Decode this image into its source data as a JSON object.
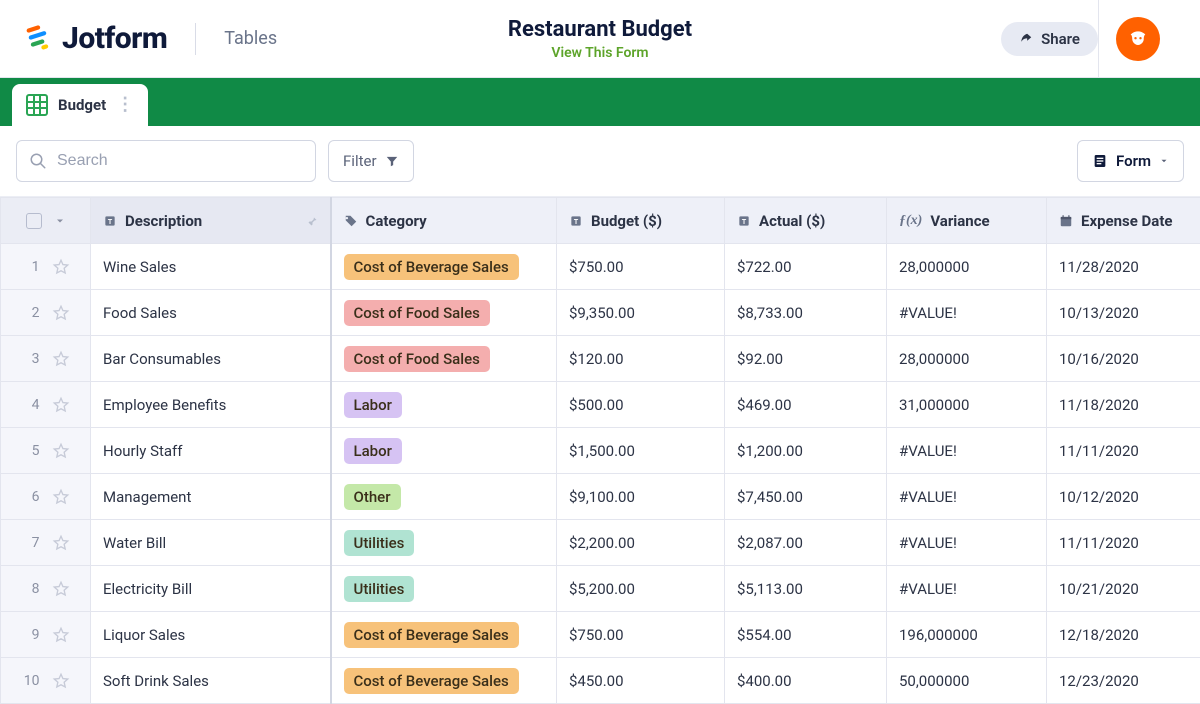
{
  "header": {
    "brand": "Jotform",
    "section": "Tables",
    "title": "Restaurant Budget",
    "view_link": "View This Form",
    "share": "Share"
  },
  "tabs": {
    "active": "Budget"
  },
  "toolbar": {
    "search_placeholder": "Search",
    "filter": "Filter",
    "form": "Form"
  },
  "columns": {
    "description": "Description",
    "category": "Category",
    "budget": "Budget ($)",
    "actual": "Actual ($)",
    "variance": "Variance",
    "expense_date": "Expense Date"
  },
  "category_styles": {
    "Cost of Beverage Sales": "tag-bev",
    "Cost of Food Sales": "tag-food",
    "Labor": "tag-labor",
    "Other": "tag-other",
    "Utilities": "tag-util"
  },
  "rows": [
    {
      "n": "1",
      "description": "Wine Sales",
      "category": "Cost of Beverage Sales",
      "budget": "$750.00",
      "actual": "$722.00",
      "variance": "28,000000",
      "date": "11/28/2020"
    },
    {
      "n": "2",
      "description": "Food Sales",
      "category": "Cost of Food Sales",
      "budget": "$9,350.00",
      "actual": "$8,733.00",
      "variance": "#VALUE!",
      "date": "10/13/2020"
    },
    {
      "n": "3",
      "description": "Bar Consumables",
      "category": "Cost of Food Sales",
      "budget": "$120.00",
      "actual": "$92.00",
      "variance": "28,000000",
      "date": "10/16/2020"
    },
    {
      "n": "4",
      "description": "Employee Benefits",
      "category": "Labor",
      "budget": "$500.00",
      "actual": "$469.00",
      "variance": "31,000000",
      "date": "11/18/2020"
    },
    {
      "n": "5",
      "description": "Hourly Staff",
      "category": "Labor",
      "budget": "$1,500.00",
      "actual": "$1,200.00",
      "variance": "#VALUE!",
      "date": "11/11/2020"
    },
    {
      "n": "6",
      "description": "Management",
      "category": "Other",
      "budget": "$9,100.00",
      "actual": "$7,450.00",
      "variance": "#VALUE!",
      "date": "10/12/2020"
    },
    {
      "n": "7",
      "description": "Water Bill",
      "category": "Utilities",
      "budget": "$2,200.00",
      "actual": "$2,087.00",
      "variance": "#VALUE!",
      "date": "11/11/2020"
    },
    {
      "n": "8",
      "description": "Electricity Bill",
      "category": "Utilities",
      "budget": "$5,200.00",
      "actual": "$5,113.00",
      "variance": "#VALUE!",
      "date": "10/21/2020"
    },
    {
      "n": "9",
      "description": "Liquor Sales",
      "category": "Cost of Beverage Sales",
      "budget": "$750.00",
      "actual": "$554.00",
      "variance": "196,000000",
      "date": "12/18/2020"
    },
    {
      "n": "10",
      "description": "Soft Drink Sales",
      "category": "Cost of Beverage Sales",
      "budget": "$450.00",
      "actual": "$400.00",
      "variance": "50,000000",
      "date": "12/23/2020"
    }
  ]
}
